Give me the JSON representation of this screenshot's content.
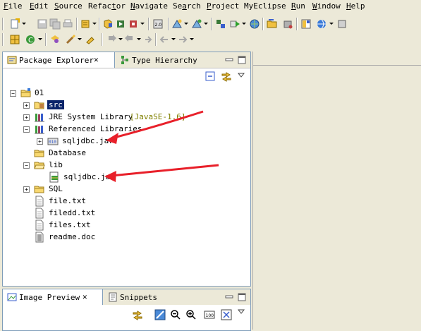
{
  "menu": [
    {
      "label": "File",
      "mnemonic": "F",
      "rest": "ile"
    },
    {
      "label": "Edit",
      "mnemonic": "E",
      "rest": "dit"
    },
    {
      "label": "Source",
      "mnemonic": "S",
      "rest": "ource"
    },
    {
      "label": "Refactor",
      "pre": "Refac",
      "mnemonic": "t",
      "rest": "or"
    },
    {
      "label": "Navigate",
      "mnemonic": "N",
      "rest": "avigate"
    },
    {
      "label": "Search",
      "pre": "Se",
      "mnemonic": "a",
      "rest": "rch"
    },
    {
      "label": "Project",
      "mnemonic": "P",
      "rest": "roject"
    },
    {
      "label": "MyEclipse",
      "mnemonic": "",
      "rest": "MyEclipse"
    },
    {
      "label": "Run",
      "mnemonic": "R",
      "rest": "un"
    },
    {
      "label": "Window",
      "mnemonic": "W",
      "rest": "indow"
    },
    {
      "label": "Help",
      "mnemonic": "H",
      "rest": "elp"
    }
  ],
  "package_explorer": {
    "tab_label": "Package Explorer",
    "tab_close": "✕",
    "other_tab_label": "Type Hierarchy"
  },
  "tree": {
    "project": "01",
    "src": "src",
    "jre": "JRE System Library",
    "jre_decor": "[JavaSE-1.6]",
    "ref_libs": "Referenced Libraries",
    "ref_jar": "sqljdbc.jar",
    "database": "Database",
    "lib": "lib",
    "lib_jar": "sqljdbc.jar",
    "sql": "SQL",
    "file1": "file.txt",
    "file2": "filedd.txt",
    "file3": "files.txt",
    "file4": "readme.doc"
  },
  "image_preview": {
    "tab_label": "Image Preview",
    "tab_close": "✕",
    "other_tab_label": "Snippets"
  },
  "colors": {
    "annotation_arrow": "#e8202a",
    "selection": "#0a246a"
  }
}
